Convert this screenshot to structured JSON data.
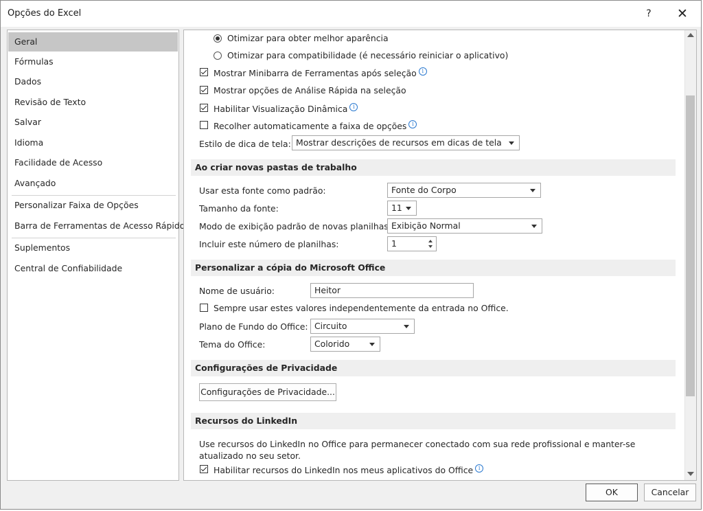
{
  "window": {
    "title": "Opções do Excel",
    "help": "?",
    "close": "✕"
  },
  "nav": {
    "items": [
      "Geral",
      "Fórmulas",
      "Dados",
      "Revisão de Texto",
      "Salvar",
      "Idioma",
      "Facilidade de Acesso",
      "Avançado",
      "Personalizar Faixa de Opções",
      "Barra de Ferramentas de Acesso Rápido",
      "Suplementos",
      "Central de Confiabilidade"
    ],
    "selected": "Geral"
  },
  "ui_options": {
    "radio_best": "Otimizar para obter melhor aparência",
    "radio_compat": "Otimizar para compatibilidade (é necessário reiniciar o aplicativo)",
    "mini_toolbar": "Mostrar Minibarra de Ferramentas após seleção",
    "quick_analysis": "Mostrar opções de Análise Rápida na seleção",
    "live_preview": "Habilitar Visualização Dinâmica",
    "collapse_ribbon": "Recolher automaticamente a faixa de opções",
    "screentip_label": "Estilo de dica de tela:",
    "screentip_value": "Mostrar descrições de recursos em dicas de tela"
  },
  "new_workbooks": {
    "header": "Ao criar novas pastas de trabalho",
    "font_label": "Usar esta fonte como padrão:",
    "font_value": "Fonte do Corpo",
    "size_label": "Tamanho da fonte:",
    "size_value": "11",
    "view_label": "Modo de exibição padrão de novas planilhas:",
    "view_value": "Exibição Normal",
    "sheets_label": "Incluir este número de planilhas:",
    "sheets_value": "1"
  },
  "personalize": {
    "header": "Personalizar a cópia do Microsoft Office",
    "username_label": "Nome de usuário:",
    "username_value": "Heitor",
    "always_use": "Sempre usar estes valores independentemente da entrada no Office.",
    "background_label": "Plano de Fundo do Office:",
    "background_value": "Circuito",
    "theme_label": "Tema do Office:",
    "theme_value": "Colorido"
  },
  "privacy": {
    "header": "Configurações de Privacidade",
    "button": "Configurações de Privacidade..."
  },
  "linkedin": {
    "header": "Recursos do LinkedIn",
    "description": "Use recursos do LinkedIn no Office para permanecer conectado com sua rede profissional e manter-se atualizado no seu setor.",
    "enable": "Habilitar recursos do LinkedIn nos meus aplicativos do Office"
  },
  "footer": {
    "ok": "OK",
    "cancel": "Cancelar"
  },
  "info_glyph": "i"
}
